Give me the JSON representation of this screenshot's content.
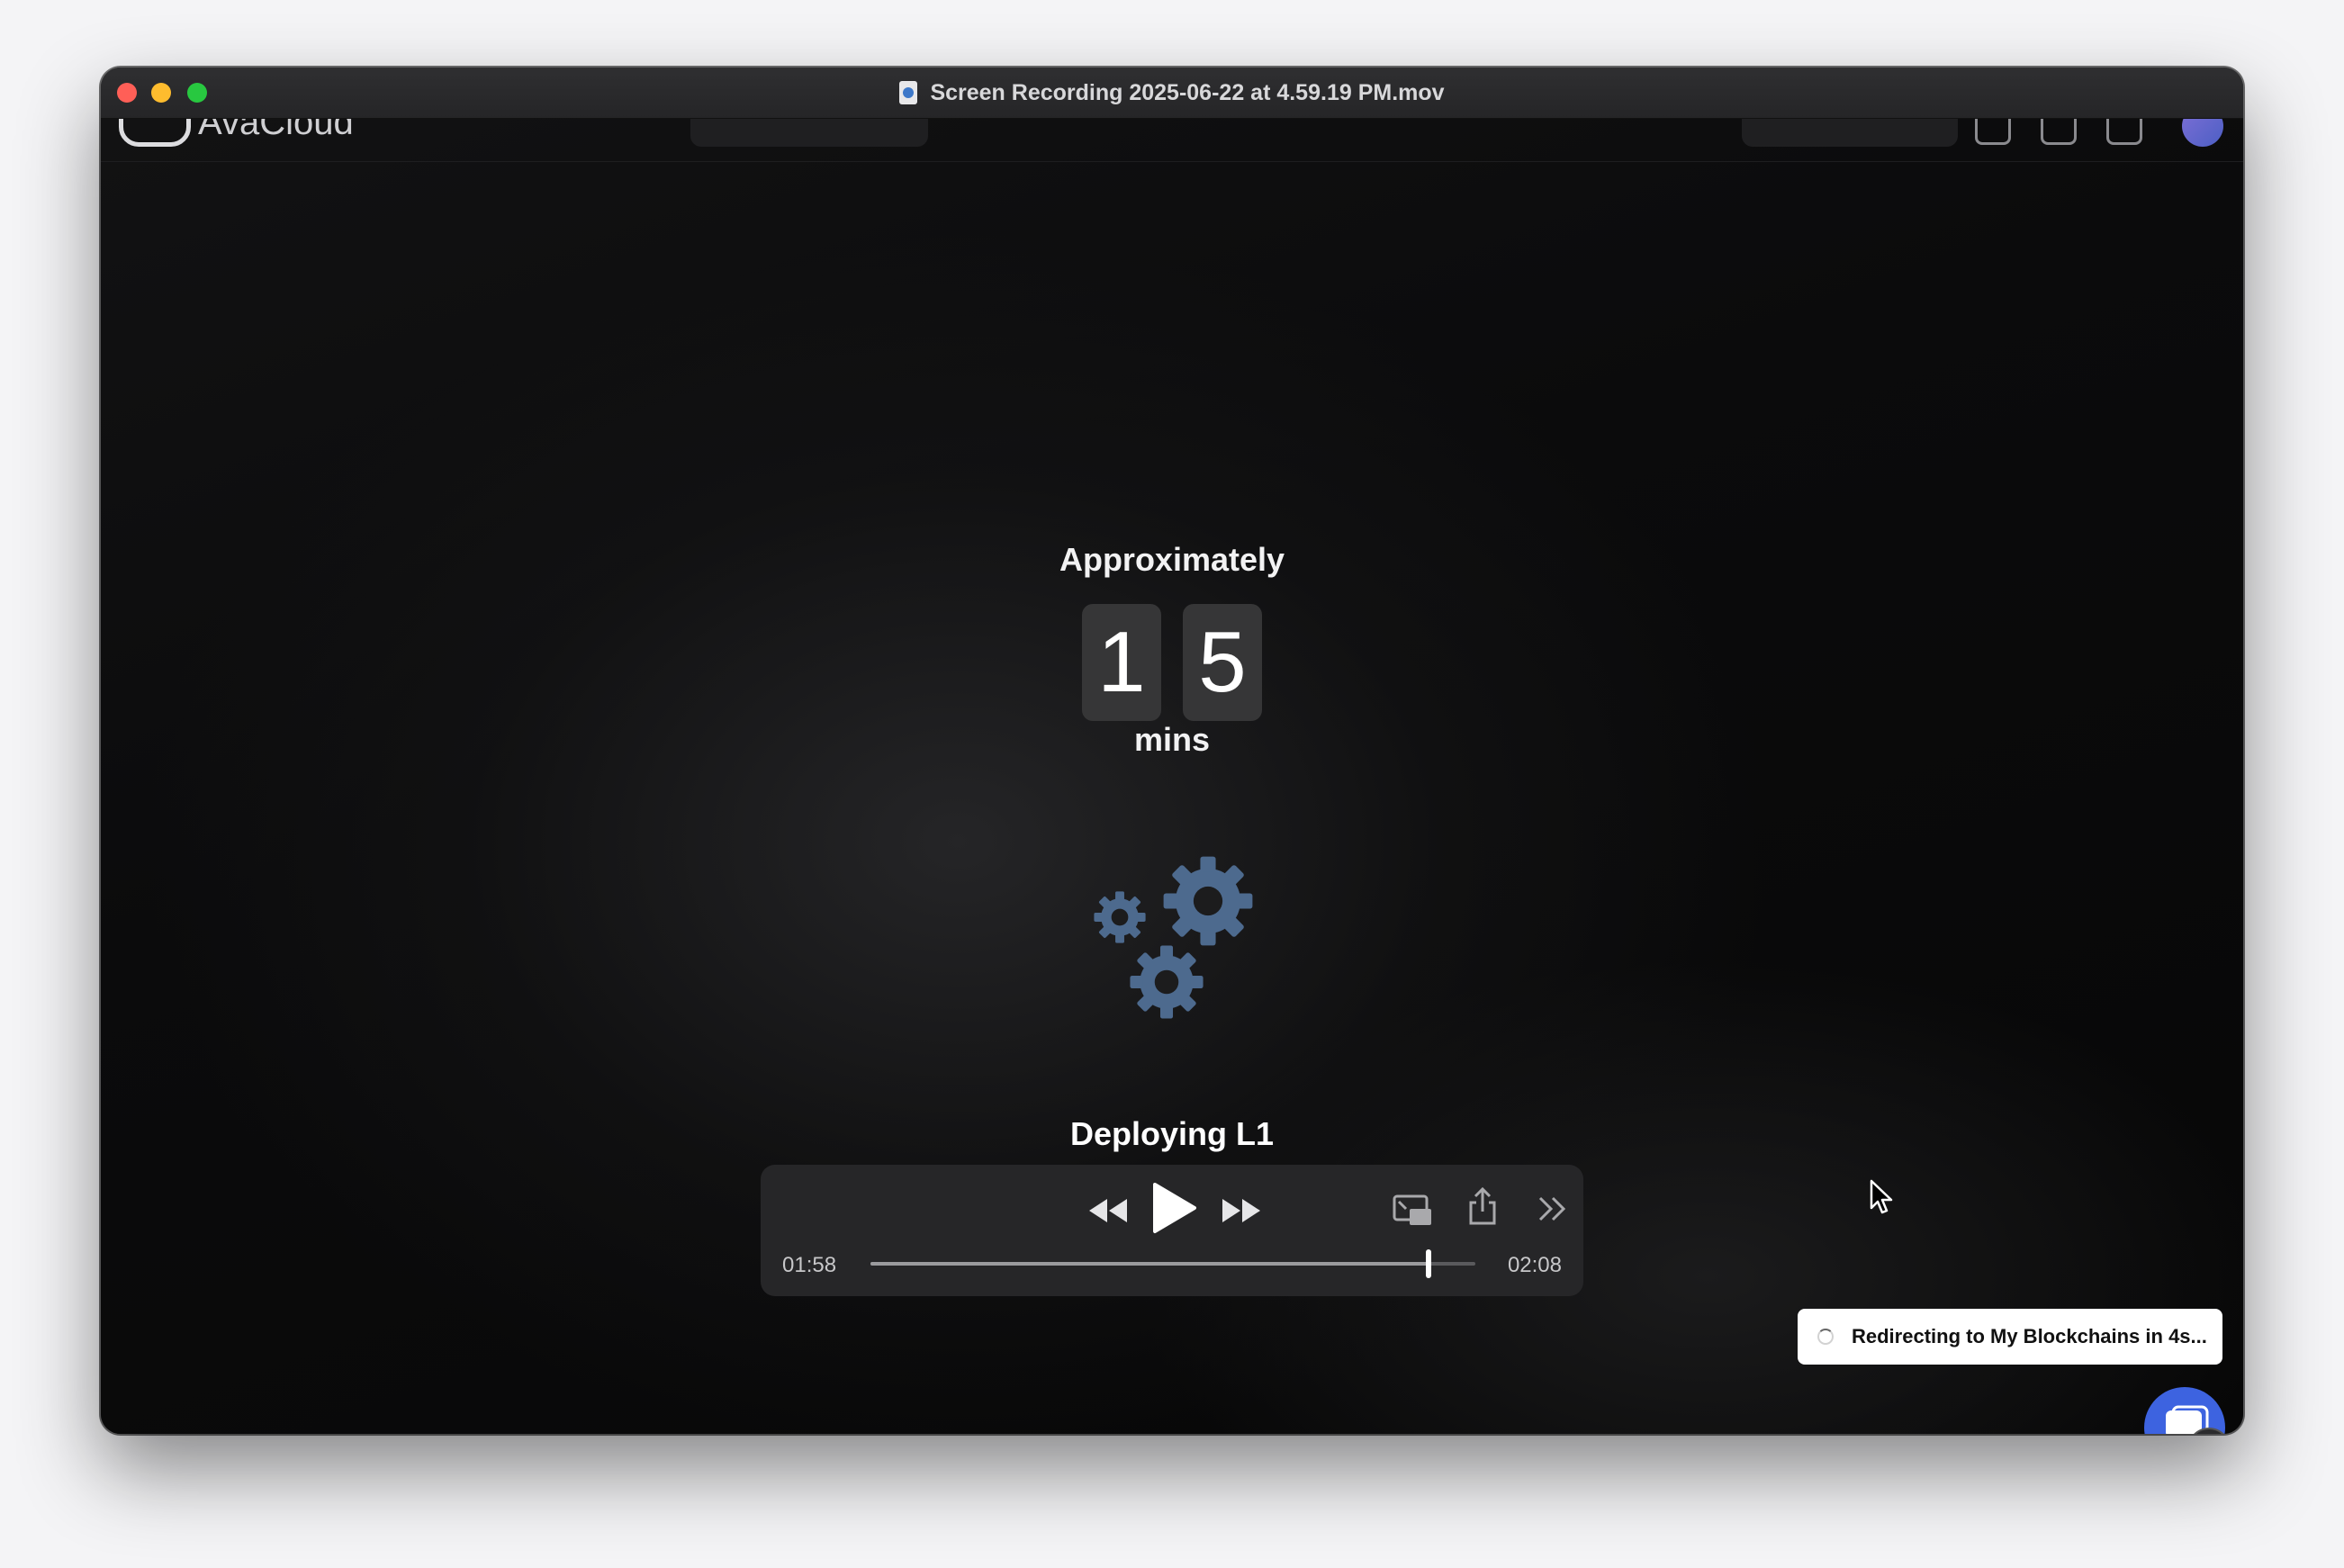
{
  "window": {
    "title": "Screen Recording 2025-06-22 at 4.59.19 PM.mov"
  },
  "app": {
    "brand": "AvaCloud"
  },
  "countdown": {
    "prefix": "Approximately",
    "digits": [
      "1",
      "5"
    ],
    "unit": "mins"
  },
  "status": {
    "label": "Deploying L1"
  },
  "player": {
    "current_time": "01:58",
    "total_time": "02:08",
    "progress": 0.922
  },
  "toast": {
    "message": "Redirecting to My Blockchains in 4s..."
  },
  "colors": {
    "gear": "#4d6a8e",
    "chat_button": "#3d63e0",
    "toast_bg": "#ffffff"
  },
  "icons": {
    "rewind": "rewind-icon",
    "play": "play-icon",
    "fast_forward": "fast-forward-icon",
    "picture_in_picture": "picture-in-picture-icon",
    "share": "share-icon",
    "more": "chevron-double-right-icon",
    "chat": "chat-icon"
  }
}
